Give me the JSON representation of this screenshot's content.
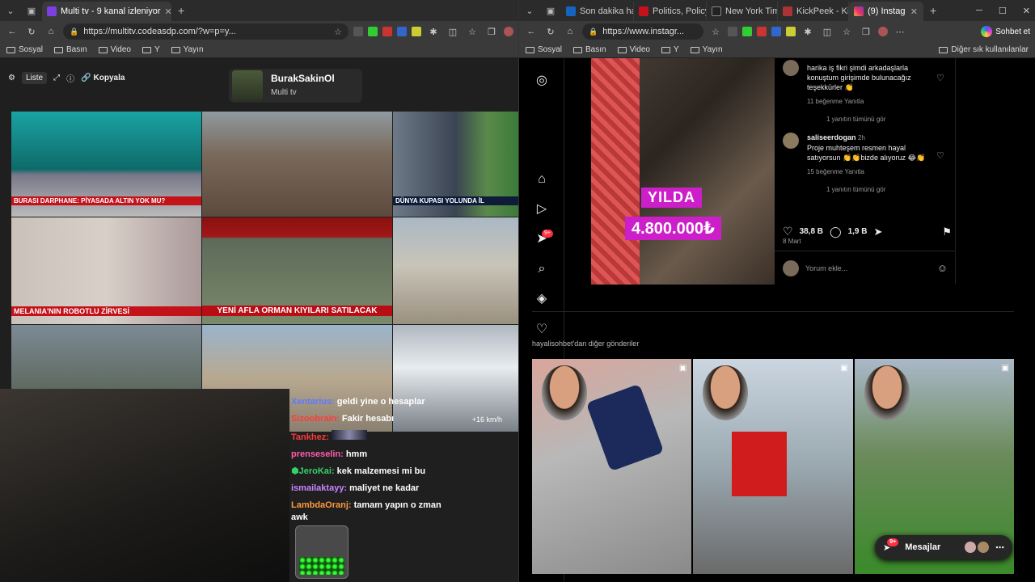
{
  "left": {
    "tab_title": "Multi tv - 9 kanal izleniyor",
    "url": "https://multitv.codeasdp.com/?w=p=y...",
    "bookmarks": [
      "Sosyal",
      "Basın",
      "Video",
      "Y",
      "Yayın"
    ],
    "toolbar": {
      "list": "Liste",
      "copy": "Kopyala"
    },
    "channel": {
      "name": "BurakSakinOl",
      "sub": "Multi tv"
    },
    "tiles": [
      {
        "caption": "BURASI DARPHANE: PİYASADA ALTIN YOK MU?"
      },
      {
        "caption": ""
      },
      {
        "caption": "DÜNYA KUPASI YOLUNDA İL"
      },
      {
        "caption": "MELANIA'NIN ROBOTLU ZİRVESİ"
      },
      {
        "caption": "YENİ AFLA ORMAN KIYILARI SATILACAK"
      },
      {
        "caption": ""
      },
      {
        "caption": ""
      },
      {
        "caption": ""
      },
      {
        "caption": ""
      }
    ],
    "weather": "+16 km/h",
    "chat": [
      {
        "user": "Xentarius:",
        "msg": "geldi yine o hesaplar",
        "color": "#5b7bff"
      },
      {
        "user": "Sizoobrain:",
        "msg": "Fakir hesabı",
        "color": "#ff3b3b"
      },
      {
        "user": "Tankhez:",
        "msg": "",
        "color": "#ff3b3b"
      },
      {
        "user": "prenseselin:",
        "msg": "hmm",
        "color": "#ff5cae"
      },
      {
        "user": "JeroKai:",
        "msg": "kek malzemesi mi bu",
        "color": "#35d06a"
      },
      {
        "user": "ismailaktayy:",
        "msg": "maliyet ne kadar",
        "color": "#c985ff"
      },
      {
        "user": "LambdaOranj:",
        "msg": "tamam yapın o zman awk",
        "color": "#ff9a3c"
      }
    ]
  },
  "right": {
    "tabs": [
      "Son dakika ha",
      "Politics, Policy",
      "New York Tim",
      "KickPeek - Kic",
      "(9) Instag"
    ],
    "url": "https://www.instagr...",
    "chat_btn": "Sohbet et",
    "bookmarks": [
      "Sosyal",
      "Basın",
      "Video",
      "Y",
      "Yayın"
    ],
    "other_bookmarks": "Diğer sık kullanılanlar",
    "sidebar_badge": "9+",
    "post": {
      "line1": "YILDA",
      "line2": "4.800.000₺",
      "comments": [
        {
          "user": "",
          "text": "harika iş fikri şimdi arkadaşlarla konuştum girişimde bulunacağız teşekkürler 👏",
          "meta": "11 beğenme   Yanıtla",
          "replies": "1 yanıtın tümünü gör"
        },
        {
          "user": "saliseerdogan",
          "time": "2h",
          "text": "Proje muhteşem resmen hayal satıyorsun 👏👏bizde alıyoruz 😂👏",
          "meta": "15 beğenme   Yanıtla",
          "replies": "1 yanıtın tümünü gör"
        }
      ],
      "likes": "38,8 B",
      "comments_count": "1,9 B",
      "date": "8 Mart",
      "add_comment": "Yorum ekle..."
    },
    "more_from": "hayalisohbet'dan diğer gönderiler",
    "messages": "Mesajlar",
    "messages_badge": "9+"
  }
}
